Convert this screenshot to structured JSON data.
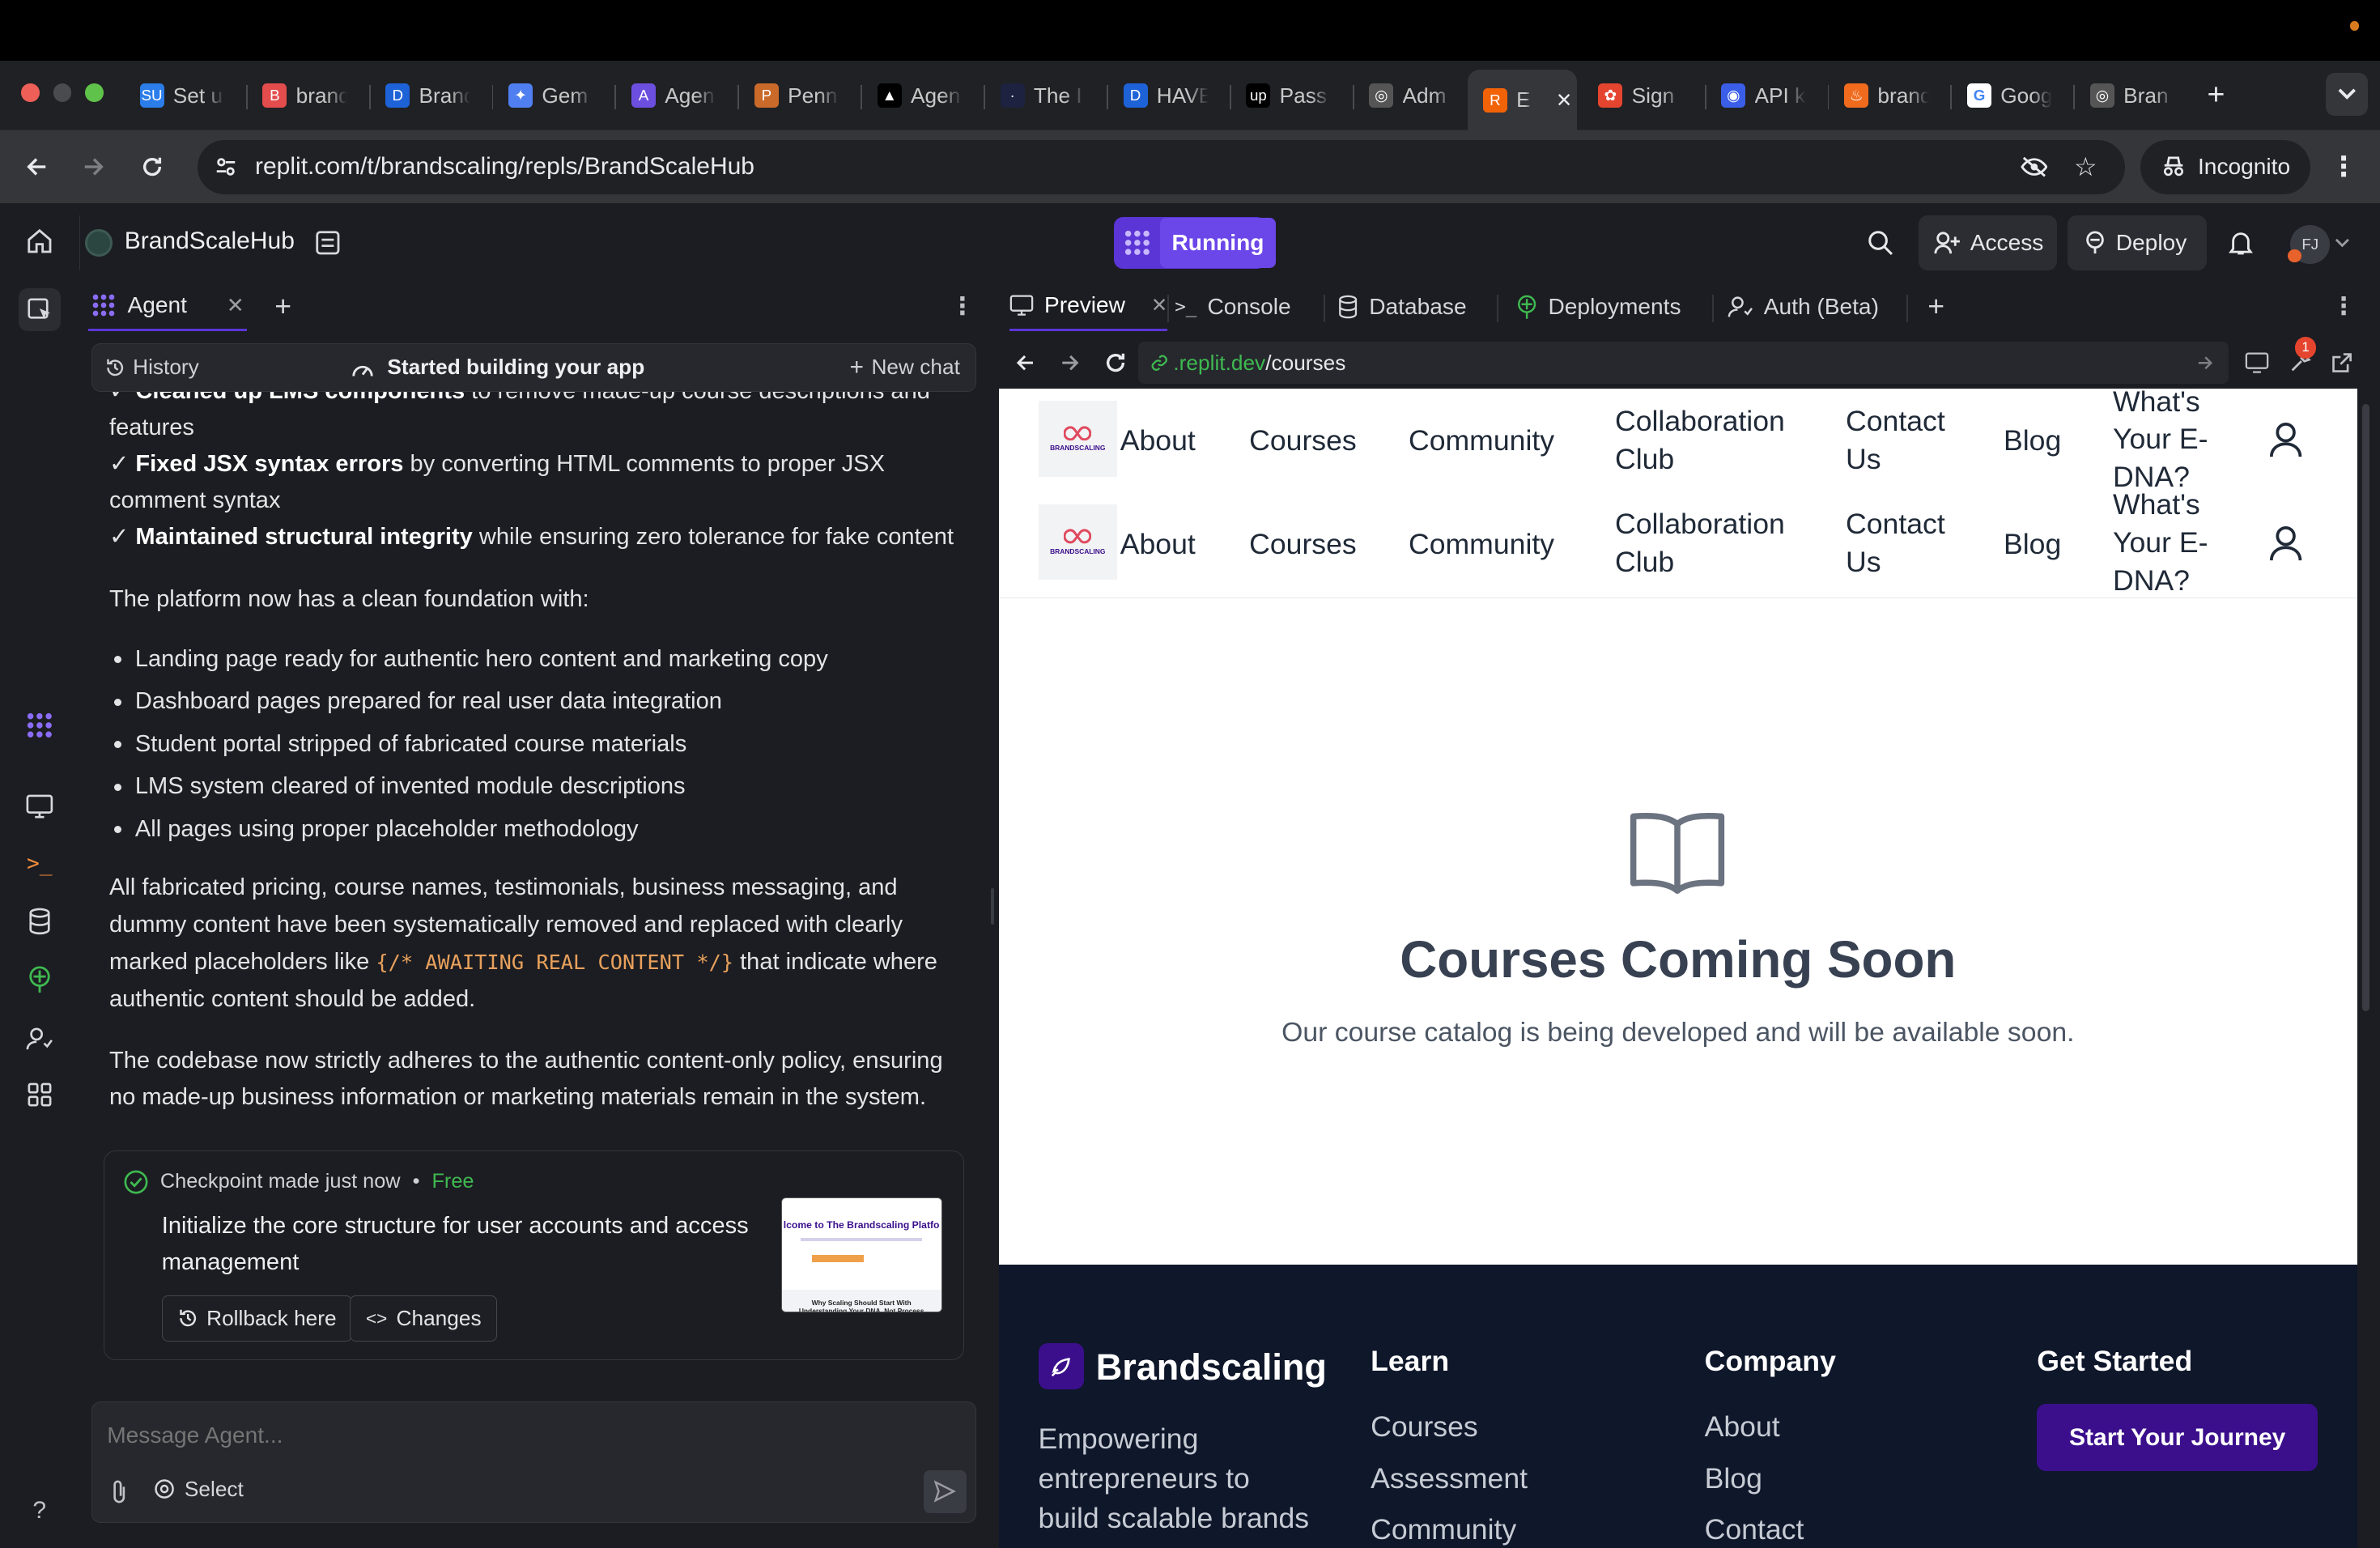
{
  "browser": {
    "tabs": [
      {
        "title": "Set u",
        "fav": "SU",
        "color": "#2b7de9"
      },
      {
        "title": "brand",
        "fav": "B",
        "color": "#e34c4c"
      },
      {
        "title": "Brand",
        "fav": "D",
        "color": "#1e62d8"
      },
      {
        "title": "Gem",
        "fav": "✦",
        "color": "#4f7ff0"
      },
      {
        "title": "Agen",
        "fav": "A",
        "color": "#6d4fe0"
      },
      {
        "title": "Penn",
        "fav": "P",
        "color": "#c96a2a"
      },
      {
        "title": "Agen",
        "fav": "▲",
        "color": "#000000"
      },
      {
        "title": "The I",
        "fav": "·",
        "color": "#1c2240"
      },
      {
        "title": "HAVE",
        "fav": "D",
        "color": "#1e62d8"
      },
      {
        "title": "Pass",
        "fav": "up",
        "color": "#000000"
      },
      {
        "title": "Adm",
        "fav": "◎",
        "color": "#555555"
      },
      {
        "title": "E",
        "fav": "R",
        "color": "#f26207"
      },
      {
        "title": "Sign",
        "fav": "✿",
        "color": "#e5452f"
      },
      {
        "title": "API k",
        "fav": "◉",
        "color": "#3b5ee8"
      },
      {
        "title": "brand",
        "fav": "♨",
        "color": "#f06b1d"
      },
      {
        "title": "Goog",
        "fav": "G",
        "color": "#ffffff"
      },
      {
        "title": "Bran",
        "fav": "◎",
        "color": "#555555"
      }
    ],
    "url": "replit.com/t/brandscaling/repls/BrandScaleHub",
    "incognito_label": "Incognito"
  },
  "header": {
    "project_name": "BrandScaleHub",
    "status": "Running",
    "access_label": "Access",
    "deploy_label": "Deploy",
    "avatar_initials": "FJ"
  },
  "agent": {
    "tab_label": "Agent",
    "history_label": "History",
    "status_text": "Started building your app",
    "new_chat_label": "New chat",
    "chat": {
      "line0_bold": "Cleaned up LMS components",
      "line0_rest": " to remove made-up course descriptions and features",
      "line1_bold": "Fixed JSX syntax errors",
      "line1_rest": " by converting HTML comments to proper JSX comment syntax",
      "line2_bold": "Maintained structural integrity",
      "line2_rest": " while ensuring zero tolerance for fake content",
      "para1": "The platform now has a clean foundation with:",
      "bullets": [
        "Landing page ready for authentic hero content and marketing copy",
        "Dashboard pages prepared for real user data integration",
        "Student portal stripped of fabricated course materials",
        "LMS system cleared of invented module descriptions",
        "All pages using proper placeholder methodology"
      ],
      "para2_a": "All fabricated pricing, course names, testimonials, business messaging, and dummy content have been systematically removed and replaced with clearly marked placeholders like ",
      "para2_code": "{/* AWAITING REAL CONTENT */}",
      "para2_b": " that indicate where authentic content should be added.",
      "para3": "The codebase now strictly adheres to the authentic content-only policy, ensuring no made-up business information or marketing materials remain in the system."
    },
    "checkpoint": {
      "status": "Checkpoint made just now",
      "dot": "•",
      "price": "Free",
      "description": "Initialize the core structure for user accounts and access management",
      "rollback_label": "Rollback here",
      "changes_label": "Changes",
      "thumb_title": "lcome to The Brandscaling Platfo",
      "thumb_sub": "Why Scaling Should Start With Understanding Your DNA, Not Process"
    },
    "input_placeholder": "Message Agent...",
    "select_label": "Select"
  },
  "workspace": {
    "tabs": [
      "Preview",
      "Console",
      "Database",
      "Deployments",
      "Auth (Beta)"
    ],
    "preview_url_domain": ".replit.dev",
    "preview_url_path": "/courses",
    "notification_count": "1"
  },
  "site": {
    "logo_text": "BRANDSCALING",
    "nav": {
      "about": "About",
      "courses": "Courses",
      "community": "Community",
      "collab_1": "Collaboration",
      "collab_2": "Club",
      "contact_1": "Contact",
      "contact_2": "Us",
      "blog": "Blog",
      "dna_1": "What's",
      "dna_2": "Your E-",
      "dna_3": "DNA?"
    },
    "hero": {
      "title": "Courses Coming Soon",
      "subtitle": "Our course catalog is being developed and will be available soon."
    },
    "footer": {
      "brand": "Brandscaling",
      "tagline_1": "Empowering",
      "tagline_2": "entrepreneurs to",
      "tagline_3": "build scalable brands",
      "learn_heading": "Learn",
      "learn_links": [
        "Courses",
        "Assessment",
        "Community"
      ],
      "company_heading": "Company",
      "company_links": [
        "About",
        "Blog",
        "Contact"
      ],
      "get_started_heading": "Get Started",
      "cta_label": "Start Your Journey"
    }
  },
  "colors": {
    "accent": "#5b35d5",
    "footer_bg": "#0f172a",
    "cta_bg": "#3b0f8c",
    "code": "#e9a15c",
    "checkpoint_green": "#3fb950"
  }
}
